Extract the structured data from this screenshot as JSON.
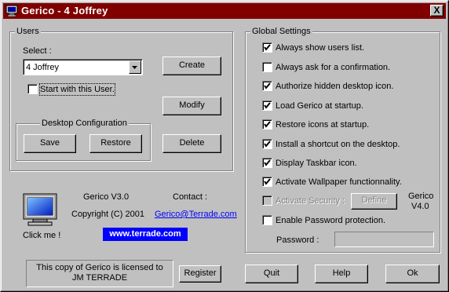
{
  "window": {
    "title": "Gerico - 4 Joffrey",
    "close_label": "X"
  },
  "users": {
    "legend": "Users",
    "select_label": "Select :",
    "selected_user": "4 Joffrey",
    "start_with_user_label": "Start with this User.",
    "start_with_user_checked": false,
    "create_label": "Create",
    "modify_label": "Modify",
    "delete_label": "Delete"
  },
  "desktop_config": {
    "legend": "Desktop Configuration",
    "save_label": "Save",
    "restore_label": "Restore"
  },
  "about": {
    "click_me": "Click me !",
    "version": "Gerico V3.0",
    "copyright": "Copyright (C) 2001",
    "contact_label": "Contact :",
    "email": "Gerico@Terrade.com",
    "website": "www.terrade.com"
  },
  "license": {
    "line1": "This copy of Gerico is licensed to",
    "line2": "JM TERRADE",
    "register_label": "Register"
  },
  "global_settings": {
    "legend": "Global Settings",
    "options": [
      {
        "label": "Always show users list.",
        "checked": true,
        "enabled": true
      },
      {
        "label": "Always ask for a confirmation.",
        "checked": false,
        "enabled": true
      },
      {
        "label": "Authorize hidden desktop icon.",
        "checked": true,
        "enabled": true
      },
      {
        "label": "Load Gerico at startup.",
        "checked": true,
        "enabled": true
      },
      {
        "label": "Restore icons at startup.",
        "checked": true,
        "enabled": true
      },
      {
        "label": "Install a shortcut on the desktop.",
        "checked": true,
        "enabled": true
      },
      {
        "label": "Display Taskbar icon.",
        "checked": true,
        "enabled": true
      },
      {
        "label": "Activate Wallpaper functionnality.",
        "checked": true,
        "enabled": true
      },
      {
        "label": "Activate Security :",
        "checked": false,
        "enabled": false
      },
      {
        "label": "Enable Password protection.",
        "checked": false,
        "enabled": true
      }
    ],
    "define_label": "Define",
    "version_line1": "Gerico",
    "version_line2": "V4.0",
    "password_label": "Password :",
    "password_value": ""
  },
  "bottom": {
    "quit_label": "Quit",
    "help_label": "Help",
    "ok_label": "Ok"
  }
}
